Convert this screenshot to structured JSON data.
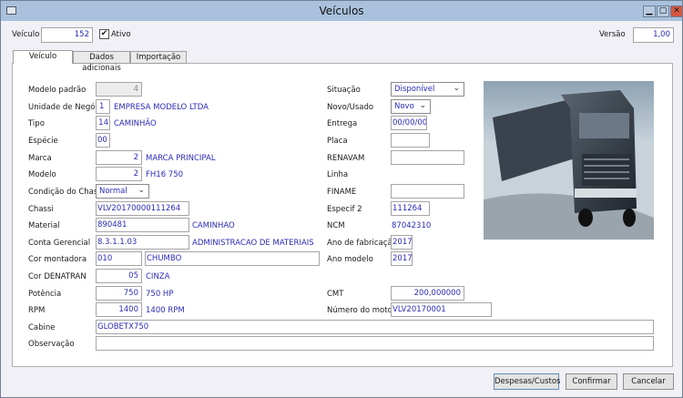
{
  "window": {
    "title": "Veículos",
    "minimize": "▁",
    "maximize": "▢",
    "close": "✕"
  },
  "header": {
    "veiculo_label": "Veículo",
    "veiculo_value": "152",
    "ativo_label": "Ativo",
    "ativo_checked": true,
    "versao_label": "Versão",
    "versao_value": "1,00"
  },
  "tabs": [
    {
      "label": "Veículo",
      "active": true
    },
    {
      "label": "Dados adicionais"
    },
    {
      "label": "Importação"
    }
  ],
  "left": {
    "modelo_padrao": {
      "label": "Modelo padrão",
      "value": "4"
    },
    "unidade": {
      "label": "Unidade de Negócio",
      "value": "1",
      "desc": "EMPRESA MODELO LTDA"
    },
    "tipo": {
      "label": "Tipo",
      "value": "14",
      "desc": "CAMINHÃO"
    },
    "especie": {
      "label": "Espécie",
      "value": "00"
    },
    "marca": {
      "label": "Marca",
      "value": "2",
      "desc": "MARCA PRINCIPAL"
    },
    "modelo": {
      "label": "Modelo",
      "value": "2",
      "desc": "FH16 750"
    },
    "condicao": {
      "label": "Condição do Chassi",
      "value": "Normal"
    },
    "chassi": {
      "label": "Chassi",
      "value": "VLV20170000111264"
    },
    "material": {
      "label": "Material",
      "value": "890481",
      "desc": "CAMINHAO"
    },
    "conta": {
      "label": "Conta Gerencial",
      "value": "8.3.1.1.03",
      "desc": "ADMINISTRACAO DE MATERIAIS"
    },
    "cor_montadora": {
      "label": "Cor montadora",
      "value": "010",
      "desc": "CHUMBO"
    },
    "cor_denatran": {
      "label": "Cor DENATRAN",
      "value": "05",
      "desc": "CINZA"
    },
    "potencia": {
      "label": "Potência",
      "value": "750",
      "desc": "750 HP"
    },
    "rpm": {
      "label": "RPM",
      "value": "1400",
      "desc": "1400 RPM"
    },
    "cabine": {
      "label": "Cabine",
      "value": "GLOBETX750"
    },
    "observacao": {
      "label": "Observação",
      "value": ""
    }
  },
  "right": {
    "situacao": {
      "label": "Situação",
      "value": "Disponível"
    },
    "novo_usado": {
      "label": "Novo/Usado",
      "value": "Novo"
    },
    "entrega": {
      "label": "Entrega",
      "value": "00/00/00"
    },
    "placa": {
      "label": "Placa",
      "value": ""
    },
    "renavam": {
      "label": "RENAVAM",
      "value": ""
    },
    "linha": {
      "label": "Linha"
    },
    "finame": {
      "label": "FINAME",
      "value": ""
    },
    "especif2": {
      "label": "Especif 2",
      "value": "111264"
    },
    "ncm": {
      "label": "NCM",
      "value": "87042310"
    },
    "ano_fab": {
      "label": "Ano de fabricação",
      "value": "2017"
    },
    "ano_modelo": {
      "label": "Ano modelo",
      "value": "2017"
    },
    "cmt": {
      "label": "CMT",
      "value": "200,000000"
    },
    "motor": {
      "label": "Número do motor",
      "value": "VLV20170001"
    }
  },
  "footer": {
    "despesas": "Despesas/Custos",
    "confirmar": "Confirmar",
    "cancelar": "Cancelar"
  }
}
